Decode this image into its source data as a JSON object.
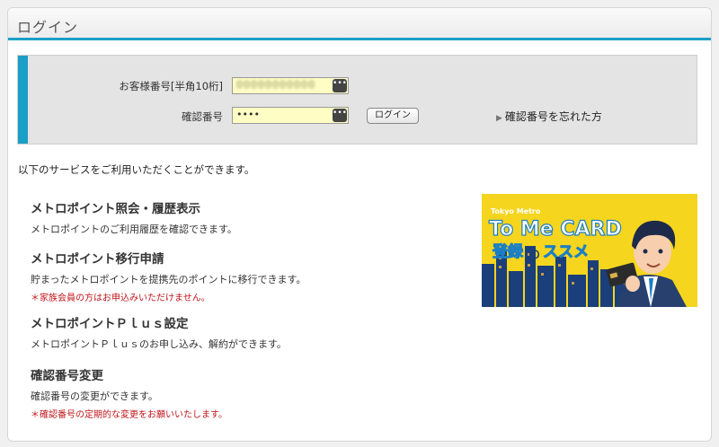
{
  "header": {
    "title": "ログイン"
  },
  "login": {
    "customer_id_label": "お客様番号[半角10桁]",
    "customer_id_value": "00000000000",
    "pin_label": "確認番号",
    "pin_value": "••••",
    "login_button": "ログイン",
    "forgot_link": "確認番号を忘れた方",
    "field_menu_glyph": "•••"
  },
  "intro": "以下のサービスをご利用いただくことができます。",
  "services": [
    {
      "title": "メトロポイント照会・履歴表示",
      "desc": "メトロポイントのご利用履歴を確認できます。",
      "note": ""
    },
    {
      "title": "メトロポイント移行申請",
      "desc": "貯まったメトロポイントを提携先のポイントに移行できます。",
      "note": "＊家族会員の方はお申込みいただけません。"
    },
    {
      "title": "メトロポイントＰｌｕｓ設定",
      "desc": "メトロポイントＰｌｕｓのお申し込み、解約ができます。",
      "note": ""
    },
    {
      "title": "確認番号変更",
      "desc": "確認番号の変更ができます。",
      "note": "＊確認番号の定期的な変更をお願いいたします。"
    }
  ],
  "banner": {
    "brand": "Tokyo Metro",
    "headline": "To Me CARD",
    "subline_a": "登録",
    "subline_b": "の",
    "subline_c": "ススメ",
    "colors": {
      "background": "#f6d51e",
      "headline": "#ffffff",
      "accent": "#1b7fc4",
      "buildings": "#1a3f7a"
    }
  },
  "colors": {
    "accent": "#1b9fc6",
    "note": "#c0161b",
    "field": "#fdfdc4"
  }
}
